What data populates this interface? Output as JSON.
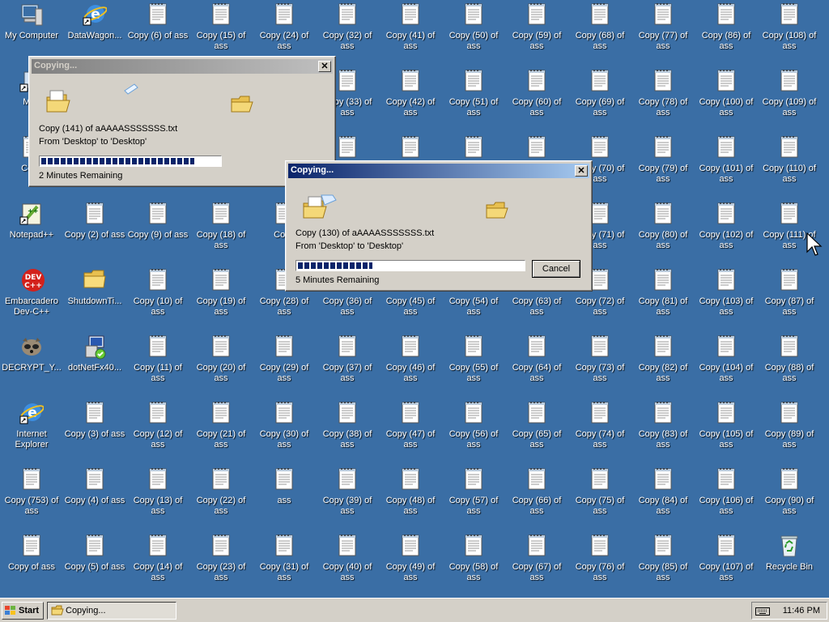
{
  "desktop": {
    "icons": [
      {
        "label": "My Computer",
        "icon": "computer-icon"
      },
      {
        "label": "DataWagon...",
        "icon": "ie-shortcut-icon"
      },
      {
        "label": "Copy (6) of ass",
        "icon": "text-file-icon"
      },
      {
        "label": "Copy (15) of ass",
        "icon": "text-file-icon"
      },
      {
        "label": "Copy (24) of ass",
        "icon": "text-file-icon"
      },
      {
        "label": "Copy (32) of ass",
        "icon": "text-file-icon"
      },
      {
        "label": "Copy (41) of ass",
        "icon": "text-file-icon"
      },
      {
        "label": "Copy (50) of ass",
        "icon": "text-file-icon"
      },
      {
        "label": "Copy (59) of ass",
        "icon": "text-file-icon"
      },
      {
        "label": "Copy (68) of ass",
        "icon": "text-file-icon"
      },
      {
        "label": "Copy (77) of ass",
        "icon": "text-file-icon"
      },
      {
        "label": "Copy (86) of ass",
        "icon": "text-file-icon"
      },
      {
        "label": "Copy (108) of ass",
        "icon": "text-file-icon"
      },
      {
        "label": "MyF",
        "icon": "shortcut-icon"
      },
      {
        "label": "",
        "icon": ""
      },
      {
        "label": "",
        "icon": ""
      },
      {
        "label": "",
        "icon": ""
      },
      {
        "label": "",
        "icon": ""
      },
      {
        "label": "Copy (33) of ass",
        "icon": "text-file-icon"
      },
      {
        "label": "Copy (42) of ass",
        "icon": "text-file-icon"
      },
      {
        "label": "Copy (51) of ass",
        "icon": "text-file-icon"
      },
      {
        "label": "Copy (60) of ass",
        "icon": "text-file-icon"
      },
      {
        "label": "Copy (69) of ass",
        "icon": "text-file-icon"
      },
      {
        "label": "Copy (78) of ass",
        "icon": "text-file-icon"
      },
      {
        "label": "Copy (100) of ass",
        "icon": "text-file-icon"
      },
      {
        "label": "Copy (109) of ass",
        "icon": "text-file-icon"
      },
      {
        "label": "Copy",
        "icon": "text-file-icon"
      },
      {
        "label": "",
        "icon": ""
      },
      {
        "label": "",
        "icon": ""
      },
      {
        "label": "",
        "icon": ""
      },
      {
        "label": "",
        "icon": ""
      },
      {
        "label": "",
        "icon": "text-file-icon"
      },
      {
        "label": "",
        "icon": "text-file-icon"
      },
      {
        "label": "",
        "icon": "text-file-icon"
      },
      {
        "label": "",
        "icon": "text-file-icon"
      },
      {
        "label": "Copy (70) of ass",
        "icon": "text-file-icon"
      },
      {
        "label": "Copy (79) of ass",
        "icon": "text-file-icon"
      },
      {
        "label": "Copy (101) of ass",
        "icon": "text-file-icon"
      },
      {
        "label": "Copy (110) of ass",
        "icon": "text-file-icon"
      },
      {
        "label": "Notepad++",
        "icon": "notepad-plus-icon"
      },
      {
        "label": "Copy (2) of ass",
        "icon": "text-file-icon"
      },
      {
        "label": "Copy (9) of ass",
        "icon": "text-file-icon"
      },
      {
        "label": "Copy (18) of ass",
        "icon": "text-file-icon"
      },
      {
        "label": "Copy",
        "icon": "text-file-icon"
      },
      {
        "label": "",
        "icon": ""
      },
      {
        "label": "",
        "icon": ""
      },
      {
        "label": "",
        "icon": ""
      },
      {
        "label": "",
        "icon": ""
      },
      {
        "label": "Copy (71) of ass",
        "icon": "text-file-icon"
      },
      {
        "label": "Copy (80) of ass",
        "icon": "text-file-icon"
      },
      {
        "label": "Copy (102) of ass",
        "icon": "text-file-icon"
      },
      {
        "label": "Copy (111) of ass",
        "icon": "text-file-icon"
      },
      {
        "label": "Embarcadero Dev-C++",
        "icon": "devcpp-icon"
      },
      {
        "label": "ShutdownTi...",
        "icon": "folder-icon"
      },
      {
        "label": "Copy (10) of ass",
        "icon": "text-file-icon"
      },
      {
        "label": "Copy (19) of ass",
        "icon": "text-file-icon"
      },
      {
        "label": "Copy (28) of ass",
        "icon": "text-file-icon"
      },
      {
        "label": "Copy (36) of ass",
        "icon": "text-file-icon"
      },
      {
        "label": "Copy (45) of ass",
        "icon": "text-file-icon"
      },
      {
        "label": "Copy (54) of ass",
        "icon": "text-file-icon"
      },
      {
        "label": "Copy (63) of ass",
        "icon": "text-file-icon"
      },
      {
        "label": "Copy (72) of ass",
        "icon": "text-file-icon"
      },
      {
        "label": "Copy (81) of ass",
        "icon": "text-file-icon"
      },
      {
        "label": "Copy (103) of ass",
        "icon": "text-file-icon"
      },
      {
        "label": "Copy (87) of ass",
        "icon": "text-file-icon"
      },
      {
        "label": "DECRYPT_Y...",
        "icon": "raccoon-icon"
      },
      {
        "label": "dotNetFx40...",
        "icon": "installer-icon"
      },
      {
        "label": "Copy (11) of ass",
        "icon": "text-file-icon"
      },
      {
        "label": "Copy (20) of ass",
        "icon": "text-file-icon"
      },
      {
        "label": "Copy (29) of ass",
        "icon": "text-file-icon"
      },
      {
        "label": "Copy (37) of ass",
        "icon": "text-file-icon"
      },
      {
        "label": "Copy (46) of ass",
        "icon": "text-file-icon"
      },
      {
        "label": "Copy (55) of ass",
        "icon": "text-file-icon"
      },
      {
        "label": "Copy (64) of ass",
        "icon": "text-file-icon"
      },
      {
        "label": "Copy (73) of ass",
        "icon": "text-file-icon"
      },
      {
        "label": "Copy (82) of ass",
        "icon": "text-file-icon"
      },
      {
        "label": "Copy (104) of ass",
        "icon": "text-file-icon"
      },
      {
        "label": "Copy (88) of ass",
        "icon": "text-file-icon"
      },
      {
        "label": "Internet Explorer",
        "icon": "ie-shortcut-icon"
      },
      {
        "label": "Copy (3) of ass",
        "icon": "text-file-icon"
      },
      {
        "label": "Copy (12) of ass",
        "icon": "text-file-icon"
      },
      {
        "label": "Copy (21) of ass",
        "icon": "text-file-icon"
      },
      {
        "label": "Copy (30) of ass",
        "icon": "text-file-icon"
      },
      {
        "label": "Copy (38) of ass",
        "icon": "text-file-icon"
      },
      {
        "label": "Copy (47) of ass",
        "icon": "text-file-icon"
      },
      {
        "label": "Copy (56) of ass",
        "icon": "text-file-icon"
      },
      {
        "label": "Copy (65) of ass",
        "icon": "text-file-icon"
      },
      {
        "label": "Copy (74) of ass",
        "icon": "text-file-icon"
      },
      {
        "label": "Copy (83) of ass",
        "icon": "text-file-icon"
      },
      {
        "label": "Copy (105) of ass",
        "icon": "text-file-icon"
      },
      {
        "label": "Copy (89) of ass",
        "icon": "text-file-icon"
      },
      {
        "label": "Copy (753) of ass",
        "icon": "text-file-icon"
      },
      {
        "label": "Copy (4) of ass",
        "icon": "text-file-icon"
      },
      {
        "label": "Copy (13) of ass",
        "icon": "text-file-icon"
      },
      {
        "label": "Copy (22) of ass",
        "icon": "text-file-icon"
      },
      {
        "label": "ass",
        "icon": "text-file-icon"
      },
      {
        "label": "Copy (39) of ass",
        "icon": "text-file-icon"
      },
      {
        "label": "Copy (48) of ass",
        "icon": "text-file-icon"
      },
      {
        "label": "Copy (57) of ass",
        "icon": "text-file-icon"
      },
      {
        "label": "Copy (66) of ass",
        "icon": "text-file-icon"
      },
      {
        "label": "Copy (75) of ass",
        "icon": "text-file-icon"
      },
      {
        "label": "Copy (84) of ass",
        "icon": "text-file-icon"
      },
      {
        "label": "Copy (106) of ass",
        "icon": "text-file-icon"
      },
      {
        "label": "Copy (90) of ass",
        "icon": "text-file-icon"
      },
      {
        "label": "Copy of ass",
        "icon": "text-file-icon"
      },
      {
        "label": "Copy (5) of ass",
        "icon": "text-file-icon"
      },
      {
        "label": "Copy (14) of ass",
        "icon": "text-file-icon"
      },
      {
        "label": "Copy (23) of ass",
        "icon": "text-file-icon"
      },
      {
        "label": "Copy (31) of ass",
        "icon": "text-file-icon"
      },
      {
        "label": "Copy (40) of ass",
        "icon": "text-file-icon"
      },
      {
        "label": "Copy (49) of ass",
        "icon": "text-file-icon"
      },
      {
        "label": "Copy (58) of ass",
        "icon": "text-file-icon"
      },
      {
        "label": "Copy (67) of ass",
        "icon": "text-file-icon"
      },
      {
        "label": "Copy (76) of ass",
        "icon": "text-file-icon"
      },
      {
        "label": "Copy (85) of ass",
        "icon": "text-file-icon"
      },
      {
        "label": "Copy (107) of ass",
        "icon": "text-file-icon"
      },
      {
        "label": "Recycle Bin",
        "icon": "recycle-bin-icon"
      }
    ]
  },
  "dialog_back": {
    "title": "Copying...",
    "file_line": "Copy (141) of aAAAASSSSSSS.txt",
    "path_line": "From 'Desktop' to 'Desktop'",
    "progress": 0.86,
    "remaining": "2 Minutes Remaining"
  },
  "dialog_front": {
    "title": "Copying...",
    "file_line": "Copy (130) of aAAAASSSSSSS.txt",
    "path_line": "From 'Desktop' to 'Desktop'",
    "progress": 0.34,
    "remaining": "5 Minutes Remaining",
    "cancel_label": "Cancel"
  },
  "taskbar": {
    "start_label": "Start",
    "task_label": "Copying...",
    "clock": "11:46 PM"
  },
  "colors": {
    "desktop": "#3a6ea5",
    "title_active": "#0a246a",
    "progress": "#0a246a"
  }
}
